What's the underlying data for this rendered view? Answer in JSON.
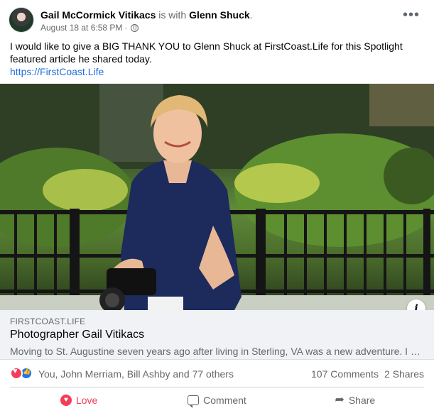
{
  "post": {
    "author": "Gail McCormick Vitikacs",
    "with_text": " is with ",
    "tagged": "Glenn Shuck",
    "tagged_suffix": ".",
    "date": "August 18 at 6:58 PM",
    "separator": "·",
    "more_label": "•••",
    "text": "I would like to give a BIG THANK YOU to Glenn Shuck at FirstCoast.Life for this Spotlight featured article he shared today.",
    "link": "https://FirstCoast.Life"
  },
  "link_card": {
    "domain": "FIRSTCOAST.LIFE",
    "title": "Photographer Gail Vitikacs",
    "description": "Moving to St. Augustine seven years ago after living in Sterling, VA was a new adventure. I bec...",
    "info_label": "i"
  },
  "stats": {
    "reactions_text": "You, John Merriam, Bill Ashby and 77 others",
    "comments": "107 Comments",
    "shares": "2 Shares"
  },
  "actions": {
    "love": "Love",
    "comment": "Comment",
    "share": "Share"
  },
  "icons": {
    "love": "heart-icon",
    "like": "thumbs-up-icon",
    "comment": "speech-bubble-icon",
    "share": "arrow-share-icon",
    "privacy": "globe-icon"
  },
  "colors": {
    "love": "#f33e58",
    "like": "#1877f2",
    "link": "#216fdb",
    "secondary_text": "#65676b"
  }
}
